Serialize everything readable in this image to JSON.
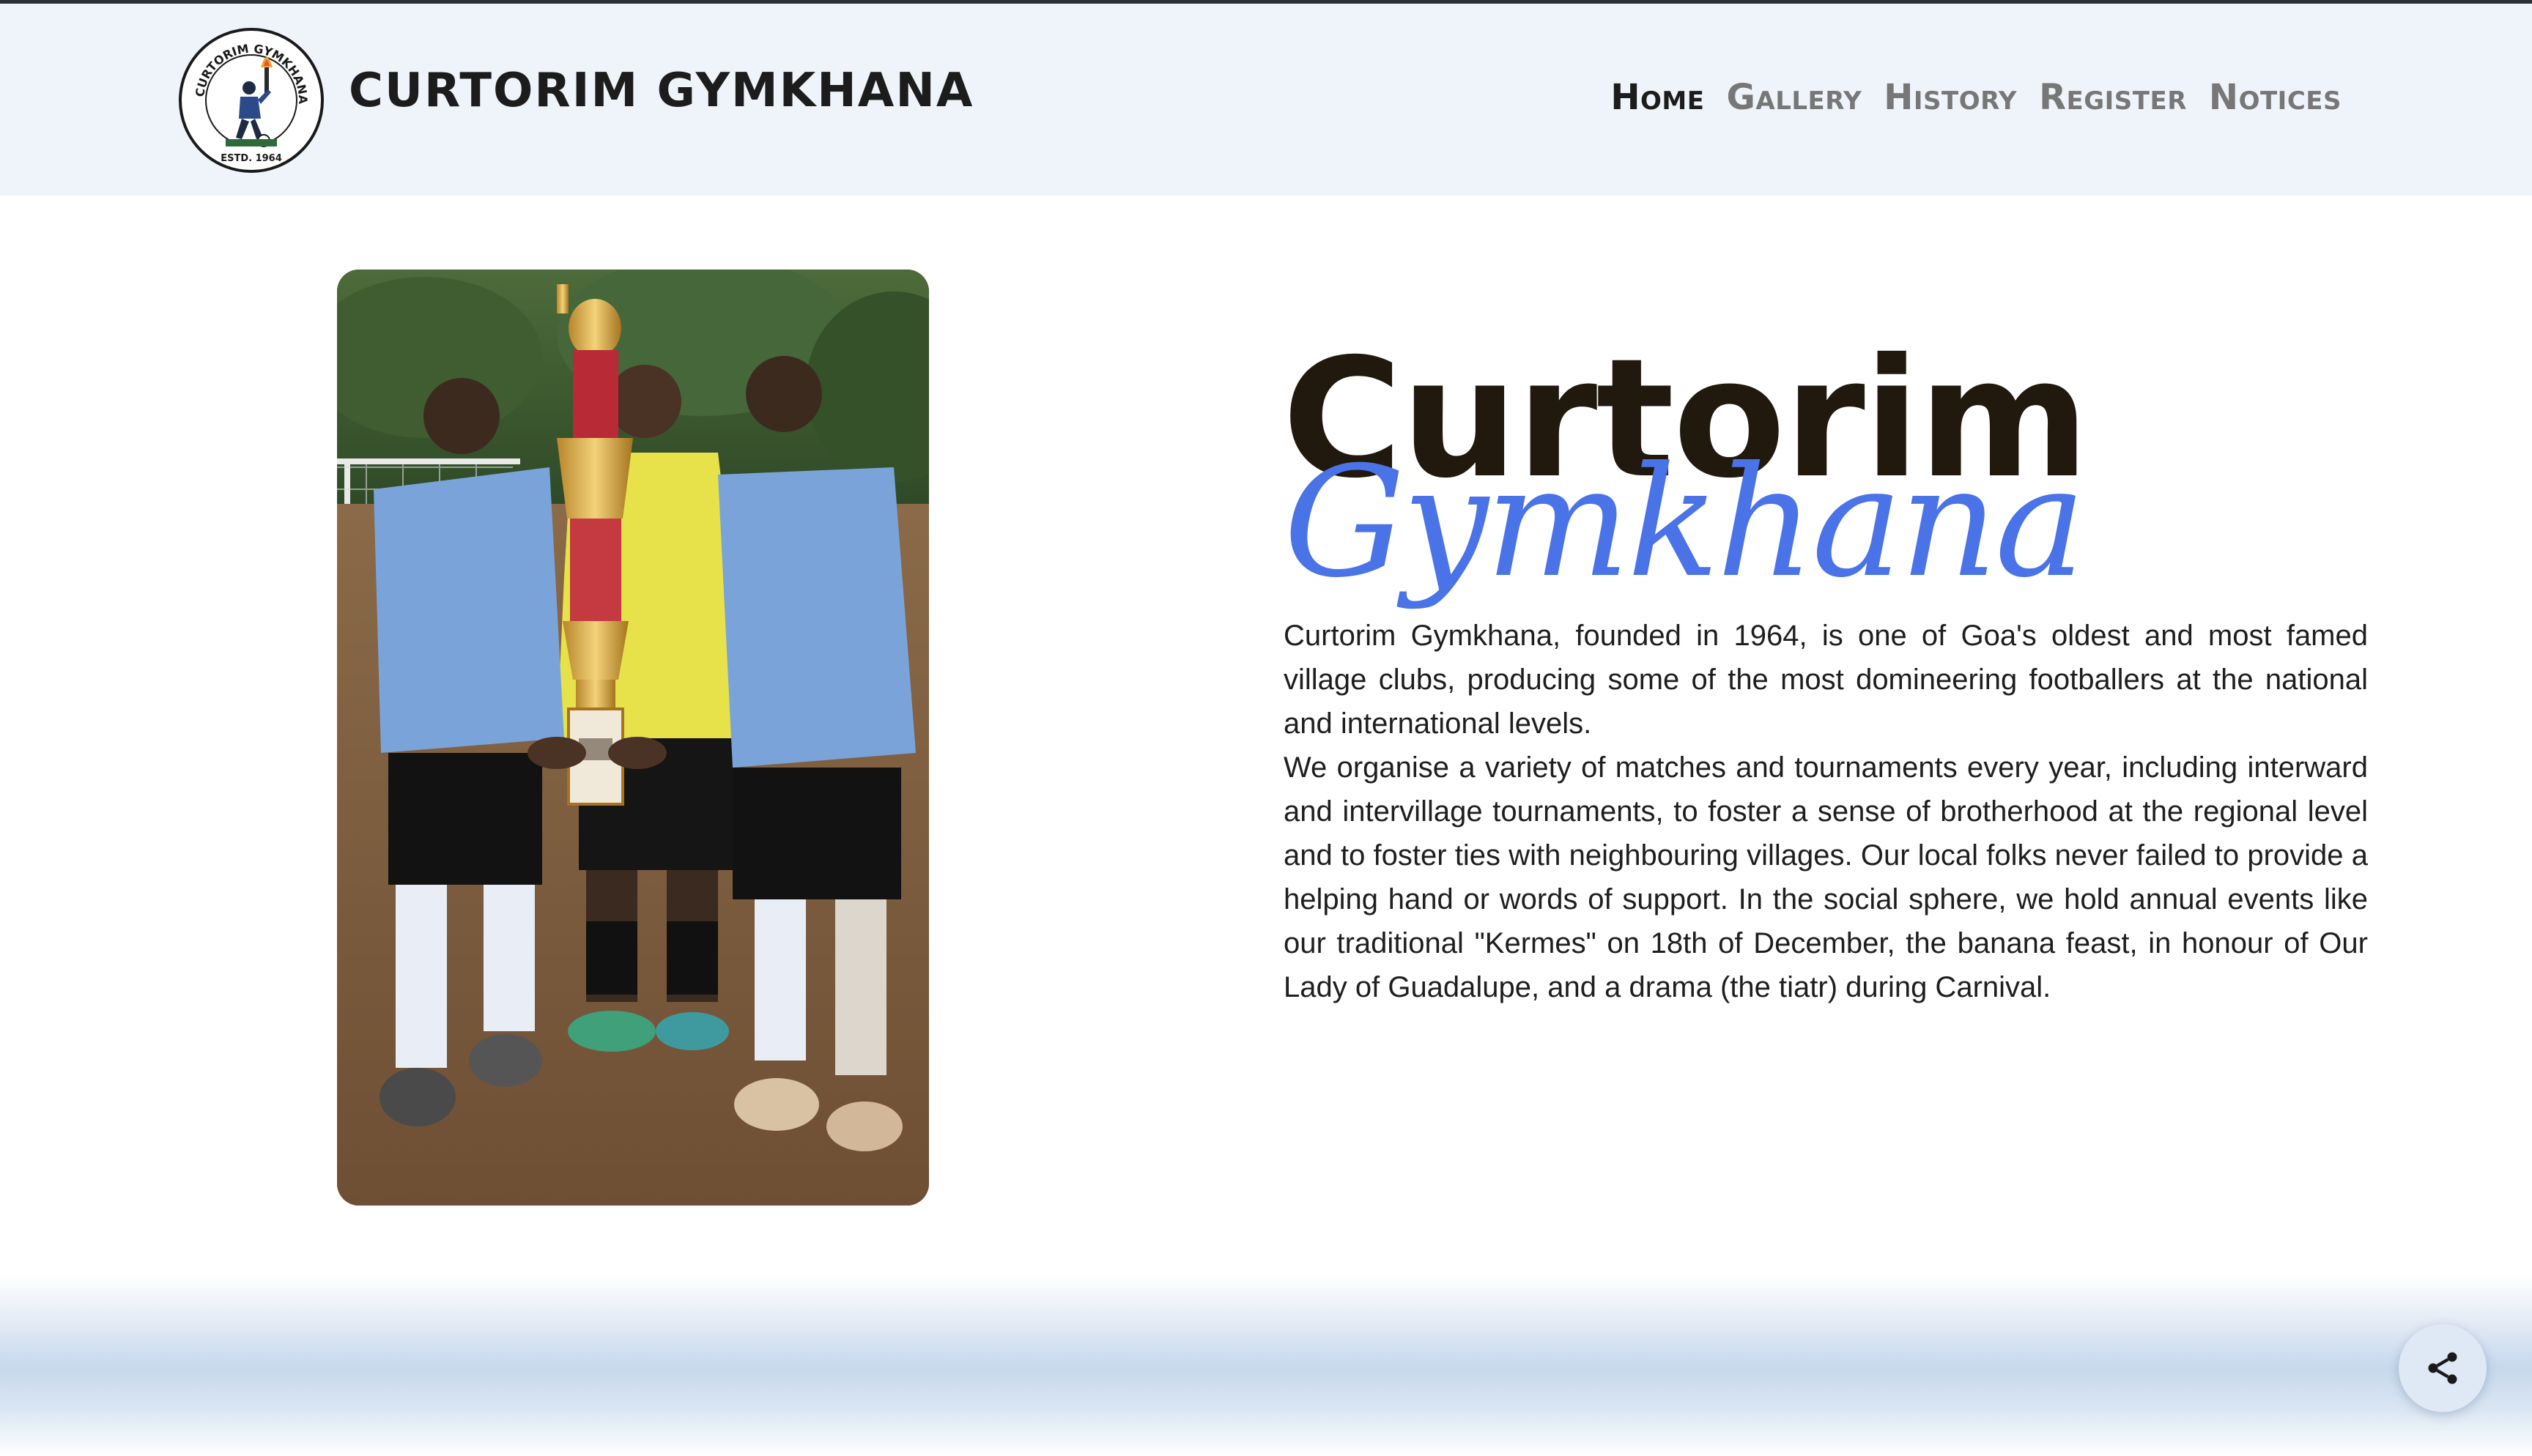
{
  "header": {
    "logo": {
      "ring_text": "CURTORIM GYMKHANA",
      "estd": "ESTD. 1964"
    },
    "brand_name": "CURTORIM GYMKHANA",
    "nav": [
      {
        "label": "Home",
        "active": true
      },
      {
        "label": "Gallery",
        "active": false
      },
      {
        "label": "History",
        "active": false
      },
      {
        "label": "Register",
        "active": false
      },
      {
        "label": "Notices",
        "active": false
      }
    ]
  },
  "hero": {
    "photo_icon": "team-trophy-photo",
    "title_main": "Curtorim",
    "title_script": "Gymkhana",
    "paragraphs": [
      "Curtorim Gymkhana, founded in 1964, is one of Goa's oldest and most famed village clubs, producing some of the most domineering footballers at the national and international levels.",
      "We organise a variety of matches and tournaments every year, including interward and intervillage tournaments, to foster a sense of brotherhood at the regional level and to foster ties with neighbouring villages. Our local folks never failed to provide a helping hand or words of support. In the social sphere, we hold annual events like our traditional \"Kermes\" on 18th of December, the banana feast, in honour of Our Lady of Guadalupe, and a drama (the tiatr) during Carnival."
    ]
  },
  "share": {
    "icon": "share-icon"
  },
  "colors": {
    "header_bg": "#eff4fa",
    "accent_blue": "#4a73e8",
    "title_dark": "#21190d",
    "nav_active": "#1c1c1c",
    "nav_inactive": "#777777"
  }
}
